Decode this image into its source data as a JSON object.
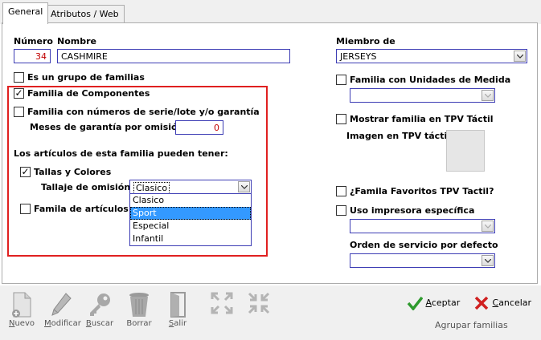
{
  "tabs": [
    {
      "label": "General",
      "active": true
    },
    {
      "label": "Atributos / Web",
      "active": false
    }
  ],
  "left": {
    "numero_label": "Número",
    "numero_value": "34",
    "nombre_label": "Nombre",
    "nombre_value": "CASHMIRE",
    "grupo_familias": {
      "label": "Es un grupo de familias",
      "checked": false
    },
    "familia_componentes": {
      "label": "Familia de Componentes",
      "checked": true
    },
    "familia_serie": {
      "label": "Familia con números de serie/lote y/o garantía",
      "checked": false
    },
    "meses_label": "Meses de garantía por omisión",
    "meses_value": "0",
    "articulos_heading": "Los artículos de esta familia pueden tener:",
    "tallas_colores": {
      "label": "Tallas y Colores",
      "checked": true
    },
    "tallaje_label": "Tallaje de omisión",
    "tallaje_value": "Clasico",
    "familia_articulos": {
      "label": "Famila de artículos co",
      "checked": false
    },
    "tallaje_options": [
      "Clasico",
      "Sport",
      "Especial",
      "Infantil"
    ],
    "tallaje_highlighted": "Sport"
  },
  "right": {
    "miembro_label": "Miembro de",
    "miembro_value": "JERSEYS",
    "unidades": {
      "label": "Familia con Unidades de Medida",
      "checked": false
    },
    "tpv": {
      "label": "Mostrar familia en TPV Táctil",
      "checked": false
    },
    "imagen_label": "Imagen en TPV táctil",
    "favoritos": {
      "label": "¿Famila Favoritos TPV Tactil?",
      "checked": false
    },
    "impresora": {
      "label": "Uso impresora específica",
      "checked": false
    },
    "orden_label": "Orden de servicio por defecto"
  },
  "toolbar": {
    "nuevo": {
      "u": "N",
      "rest": "uevo",
      "icon": "new-document-icon"
    },
    "modificar": {
      "u": "M",
      "rest": "odificar",
      "icon": "pencil-icon"
    },
    "buscar": {
      "u": "B",
      "rest": "uscar",
      "icon": "key-icon"
    },
    "borrar": {
      "label": "Borrar",
      "icon": "trash-icon"
    },
    "salir": {
      "u": "S",
      "rest": "alir",
      "icon": "exit-door-icon"
    },
    "expand_icon": "expand-icon",
    "collapse_icon": "collapse-icon",
    "aceptar": {
      "u": "A",
      "rest": "ceptar",
      "icon": "check-icon"
    },
    "cancelar": {
      "u": "C",
      "rest": "ancelar",
      "icon": "cross-icon"
    },
    "agrupar": "Agrupar familias"
  },
  "colors": {
    "accent_border": "#3c3cb4",
    "highlight_box": "#e02020",
    "selection": "#3399ff",
    "value_red": "#c00000"
  }
}
